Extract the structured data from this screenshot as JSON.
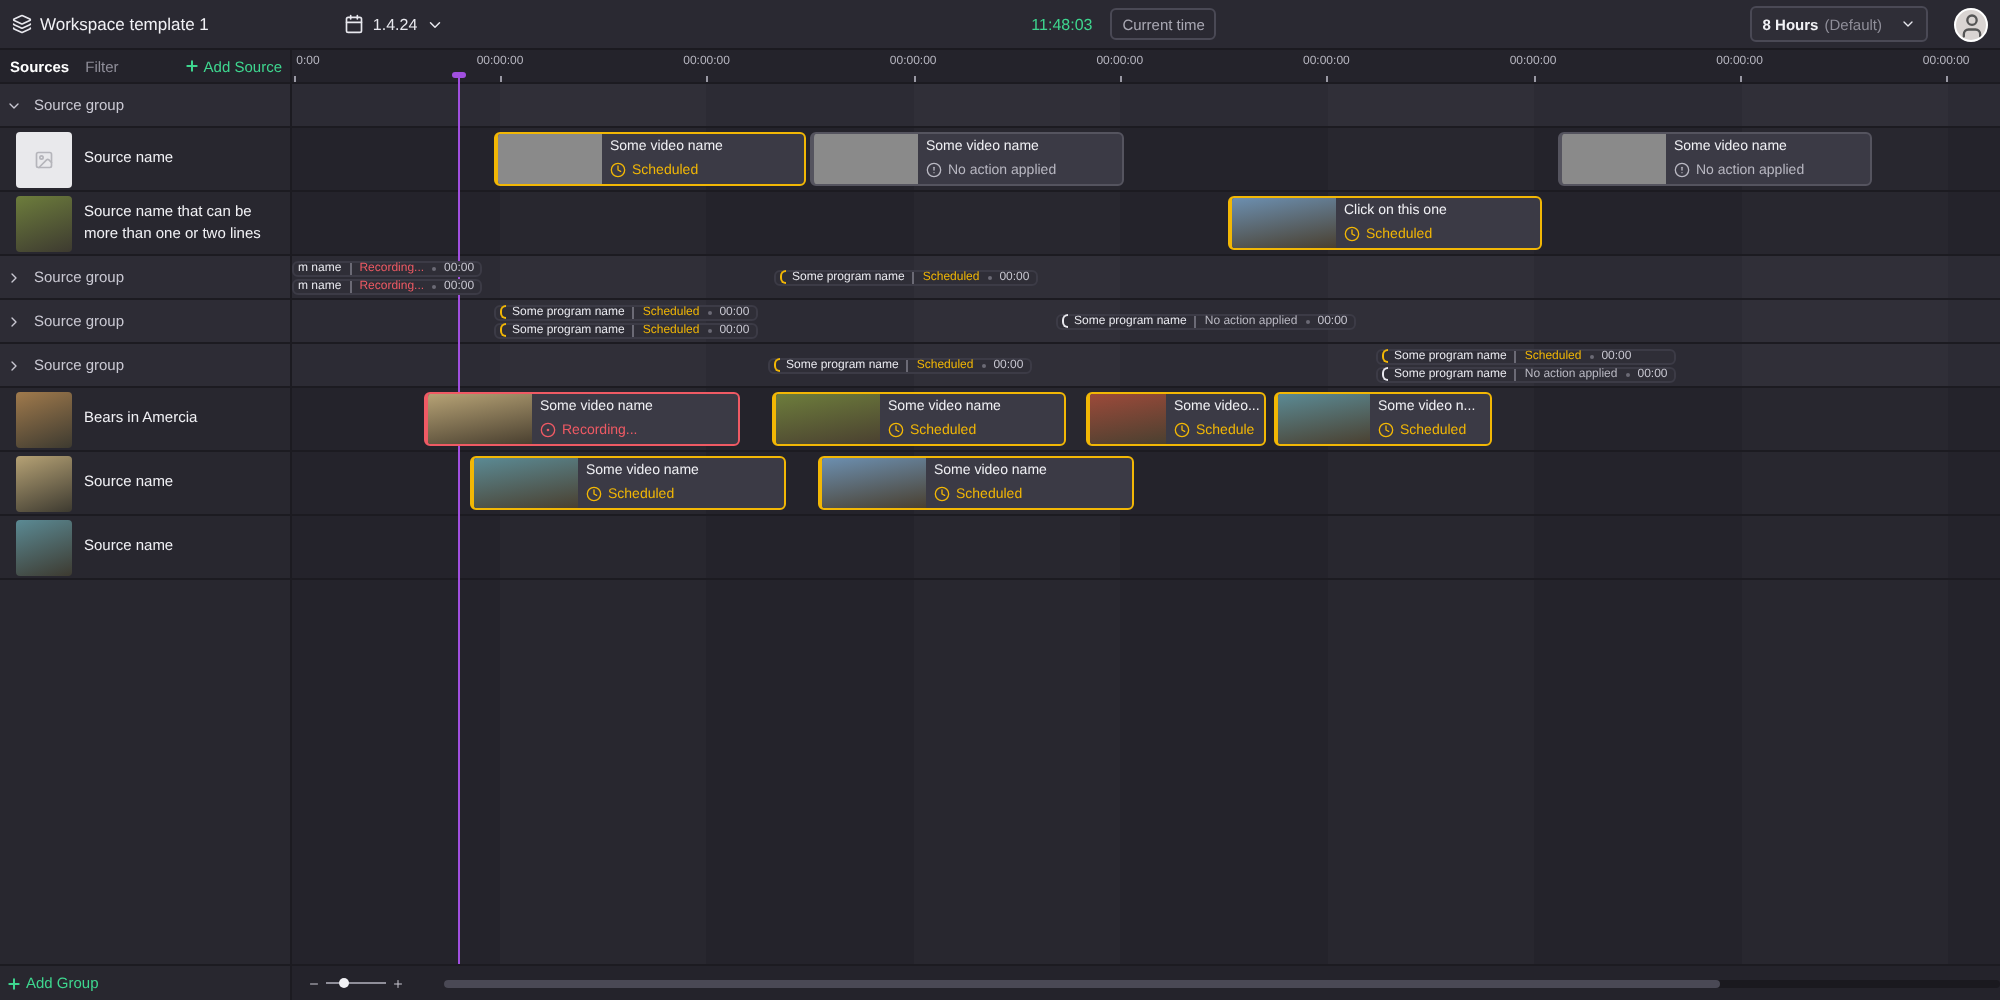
{
  "header": {
    "workspace_title": "Workspace template 1",
    "version": "1.4.24",
    "clock": "11:48:03",
    "current_time_button": "Current time",
    "zoom_select": {
      "value": "8 Hours",
      "note": "(Default)"
    }
  },
  "sidebar": {
    "tabs": [
      {
        "label": "Sources",
        "selected": true
      },
      {
        "label": "Filter",
        "selected": false
      }
    ],
    "add_source": "Add Source",
    "add_group": "Add Group"
  },
  "ruler": {
    "ticks": [
      "0:00",
      "00:00:00",
      "00:00:00",
      "00:00:00",
      "00:00:00",
      "00:00:00",
      "00:00:00",
      "00:00:00",
      "00:00:00"
    ]
  },
  "rows": [
    {
      "kind": "group",
      "label": "Source group",
      "expanded": true
    },
    {
      "kind": "source",
      "label": "Source name",
      "photo": false,
      "clips": [
        {
          "title": "Some video name",
          "status": "Scheduled",
          "kind": "scheduled",
          "photo": false
        },
        {
          "title": "Some video name",
          "status": "No action applied",
          "kind": "none",
          "photo": false
        },
        {
          "title": "Some video name",
          "status": "No action applied",
          "kind": "none",
          "photo": false
        }
      ]
    },
    {
      "kind": "source",
      "label": "Source name that can be more than one or two lines",
      "photo": true,
      "clips": [
        {
          "title": "Click on this one",
          "status": "Scheduled",
          "kind": "scheduled",
          "photo": true
        }
      ]
    },
    {
      "kind": "group",
      "label": "Source group",
      "expanded": false,
      "programs": [
        {
          "lines": [
            {
              "name": "m name",
              "status": "Recording...",
              "kind": "recording",
              "time": "00:00"
            },
            {
              "name": "m name",
              "status": "Recording...",
              "kind": "recording",
              "time": "00:00"
            }
          ]
        },
        {
          "lines": [
            {
              "name": "Some program name",
              "status": "Scheduled",
              "kind": "scheduled",
              "time": "00:00"
            }
          ]
        }
      ]
    },
    {
      "kind": "group",
      "label": "Source group",
      "expanded": false,
      "programs": [
        {
          "lines": [
            {
              "name": "Some program name",
              "status": "Scheduled",
              "kind": "scheduled",
              "time": "00:00"
            },
            {
              "name": "Some program name",
              "status": "Scheduled",
              "kind": "scheduled",
              "time": "00:00"
            }
          ]
        },
        {
          "lines": [
            {
              "name": "Some program name",
              "status": "No action applied",
              "kind": "none",
              "time": "00:00"
            }
          ]
        }
      ]
    },
    {
      "kind": "group",
      "label": "Source group",
      "expanded": false,
      "programs": [
        {
          "lines": [
            {
              "name": "Some program name",
              "status": "Scheduled",
              "kind": "scheduled",
              "time": "00:00"
            }
          ]
        },
        {
          "lines": [
            {
              "name": "Some program name",
              "status": "Scheduled",
              "kind": "scheduled",
              "time": "00:00"
            },
            {
              "name": "Some program name",
              "status": "No action applied",
              "kind": "none",
              "time": "00:00"
            }
          ]
        }
      ]
    },
    {
      "kind": "source",
      "label": "Bears in Amercia",
      "photo": true,
      "clips": [
        {
          "title": "Some video name",
          "status": "Recording...",
          "kind": "recording",
          "photo": true
        },
        {
          "title": "Some video name",
          "status": "Scheduled",
          "kind": "scheduled",
          "photo": true
        },
        {
          "title": "Some video...",
          "status": "Schedule",
          "kind": "scheduled",
          "photo": true
        },
        {
          "title": "Some video n...",
          "status": "Scheduled",
          "kind": "scheduled",
          "photo": true
        }
      ]
    },
    {
      "kind": "source",
      "label": "Source name",
      "photo": true,
      "clips": [
        {
          "title": "Some video name",
          "status": "Scheduled",
          "kind": "scheduled",
          "photo": true
        },
        {
          "title": "Some video name",
          "status": "Scheduled",
          "kind": "scheduled",
          "photo": true
        }
      ]
    },
    {
      "kind": "source",
      "label": "Source name",
      "photo": true
    }
  ],
  "zoom_slider": {
    "level": 0.3
  }
}
